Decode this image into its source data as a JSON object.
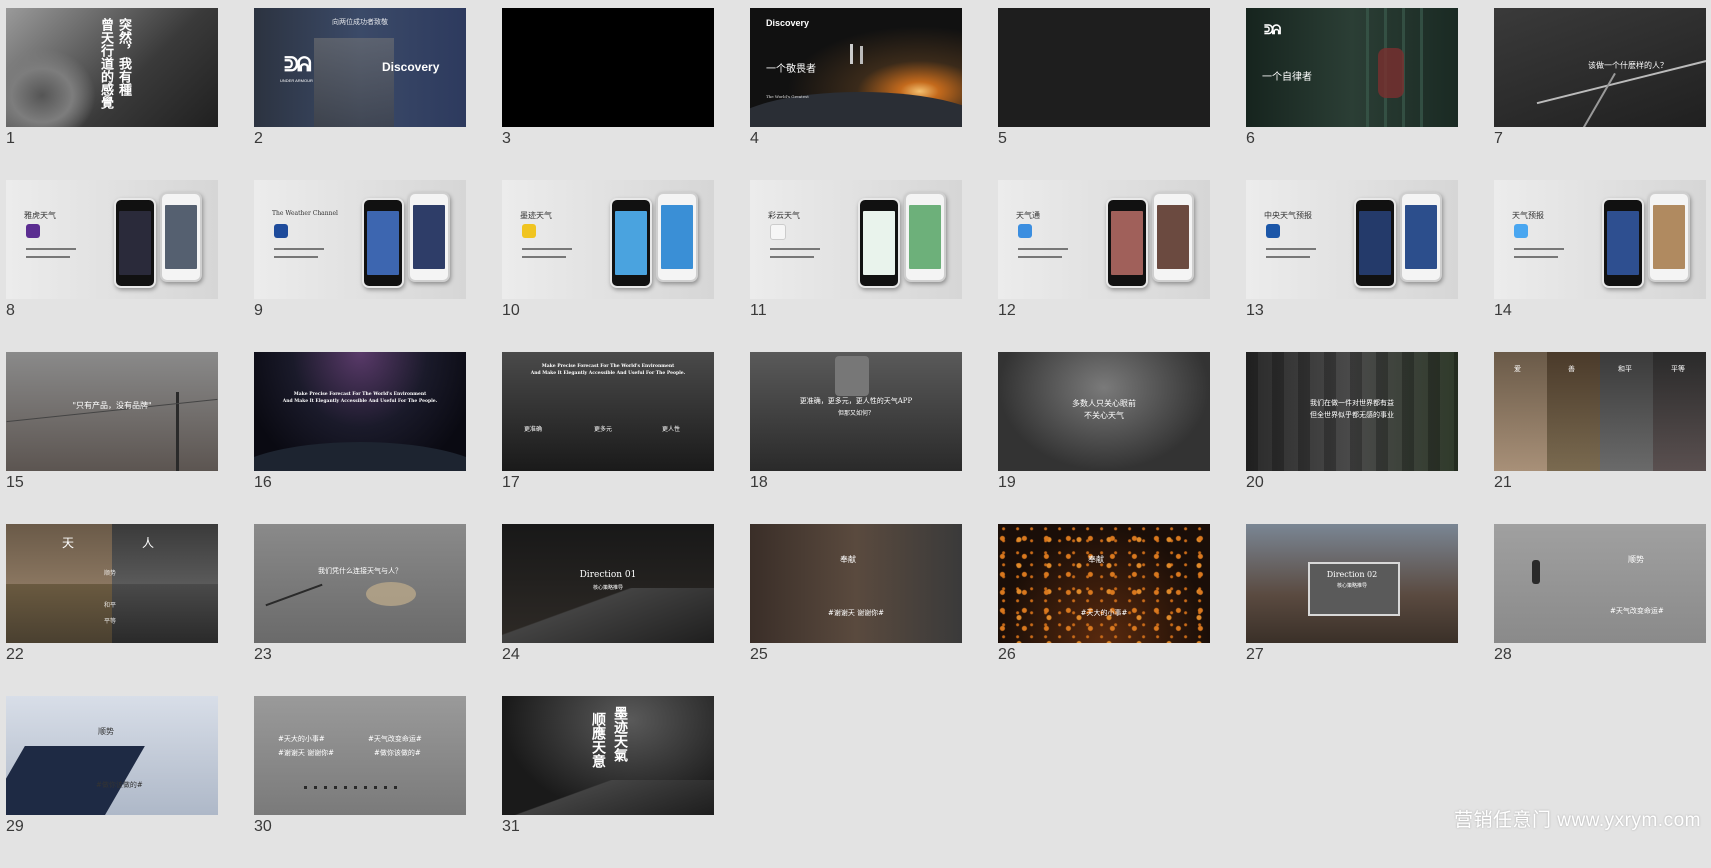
{
  "slides": [
    {
      "n": "1",
      "texts": [
        "曾天行道的感覺",
        "突然，我有種"
      ]
    },
    {
      "n": "2",
      "texts": [
        "向两位成功者致敬",
        "UNDER ARMOUR",
        "Discovery"
      ]
    },
    {
      "n": "3",
      "texts": []
    },
    {
      "n": "4",
      "texts": [
        "Discovery",
        "一个敬畏者",
        "The World's Greatest"
      ]
    },
    {
      "n": "5",
      "texts": []
    },
    {
      "n": "6",
      "texts": [
        "一个自律者"
      ]
    },
    {
      "n": "7",
      "texts": [
        "该做一个什麽样的人？"
      ]
    },
    {
      "n": "8",
      "texts": [
        "雅虎天气"
      ]
    },
    {
      "n": "9",
      "texts": [
        "The Weather Channel"
      ]
    },
    {
      "n": "10",
      "texts": [
        "墨迹天气"
      ]
    },
    {
      "n": "11",
      "texts": [
        "彩云天气"
      ]
    },
    {
      "n": "12",
      "texts": [
        "天气通"
      ]
    },
    {
      "n": "13",
      "texts": [
        "中央天气预报"
      ]
    },
    {
      "n": "14",
      "texts": [
        "天气预报"
      ]
    },
    {
      "n": "15",
      "texts": [
        "\"只有产品，没有品牌\""
      ]
    },
    {
      "n": "16",
      "texts": [
        "Make Precise Forecast For The World's Environment",
        "And Make It Elegantly Accessible And Useful For The People."
      ]
    },
    {
      "n": "17",
      "texts": [
        "Make Precise Forecast For The World's Environment",
        "And Make It Elegantly Accessible And Useful For The People.",
        "更准确",
        "更多元",
        "更人性"
      ]
    },
    {
      "n": "18",
      "texts": [
        "更准确，更多元，更人性的天气APP",
        "但那又如何？"
      ]
    },
    {
      "n": "19",
      "texts": [
        "多数人只关心眼前",
        "不关心天气"
      ]
    },
    {
      "n": "20",
      "texts": [
        "我们在做一件对世界都有益",
        "但全世界似乎都无感的事业"
      ]
    },
    {
      "n": "21",
      "texts": [
        "爱",
        "善",
        "和平",
        "平等"
      ]
    },
    {
      "n": "22",
      "texts": [
        "天",
        "人",
        "顺势",
        "→",
        "和平",
        "平等"
      ]
    },
    {
      "n": "23",
      "texts": [
        "我们凭什么连接天气与人？"
      ]
    },
    {
      "n": "24",
      "texts": [
        "Direction 01",
        "核心策略推导"
      ]
    },
    {
      "n": "25",
      "texts": [
        "奉献",
        "#谢谢天 谢谢你#"
      ]
    },
    {
      "n": "26",
      "texts": [
        "奉献",
        "#天大的小事#"
      ]
    },
    {
      "n": "27",
      "texts": [
        "Direction 02",
        "核心策略推导"
      ]
    },
    {
      "n": "28",
      "texts": [
        "顺势",
        "#天气改变命运#"
      ]
    },
    {
      "n": "29",
      "texts": [
        "顺势",
        "#做你该做的#"
      ]
    },
    {
      "n": "30",
      "texts": [
        "#天大的小事#",
        "#谢谢天 谢谢你#",
        "#天气改变命运#",
        "#做你该做的#"
      ]
    },
    {
      "n": "31",
      "texts": [
        "墨迹天氣",
        "顺應天意"
      ]
    }
  ],
  "watermark": "营销任意门 www.yxrym.com"
}
